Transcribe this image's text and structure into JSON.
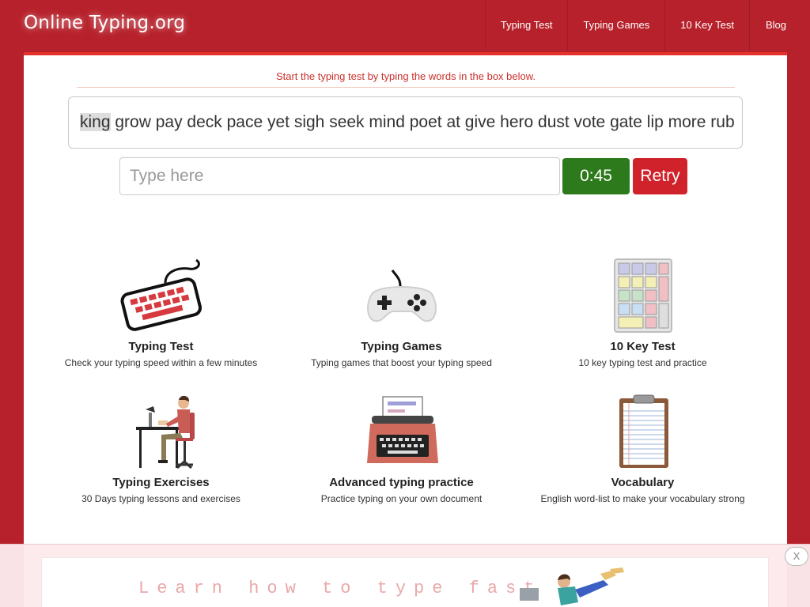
{
  "brand": "Online Typing.org",
  "nav": [
    "Typing Test",
    "Typing Games",
    "10 Key Test",
    "Blog"
  ],
  "instruction": "Start the typing test by typing the words in the box below.",
  "words": {
    "current": "king",
    "rest": "grow pay deck pace yet sigh seek mind poet at give hero dust vote gate lip more rub"
  },
  "input": {
    "placeholder": "Type here",
    "value": ""
  },
  "timer": "0:45",
  "retry_label": "Retry",
  "features": [
    {
      "icon": "keyboard-icon",
      "title": "Typing Test",
      "desc": "Check your typing speed within a few minutes"
    },
    {
      "icon": "gamepad-icon",
      "title": "Typing Games",
      "desc": "Typing games that boost your typing speed"
    },
    {
      "icon": "numpad-icon",
      "title": "10 Key Test",
      "desc": "10 key typing test and practice"
    },
    {
      "icon": "person-at-desk-icon",
      "title": "Typing Exercises",
      "desc": "30 Days typing lessons and exercises"
    },
    {
      "icon": "typewriter-icon",
      "title": "Advanced typing practice",
      "desc": "Practice typing on your own document"
    },
    {
      "icon": "clipboard-icon",
      "title": "Vocabulary",
      "desc": "English word-list to make your vocabulary strong"
    }
  ],
  "ad": {
    "text": "Learn how to type fast",
    "close_label": "X"
  },
  "colors": {
    "brand_red": "#b7212b",
    "timer_green": "#2d7a1c",
    "retry_red": "#d0222b",
    "instruction_red": "#c9302c"
  }
}
